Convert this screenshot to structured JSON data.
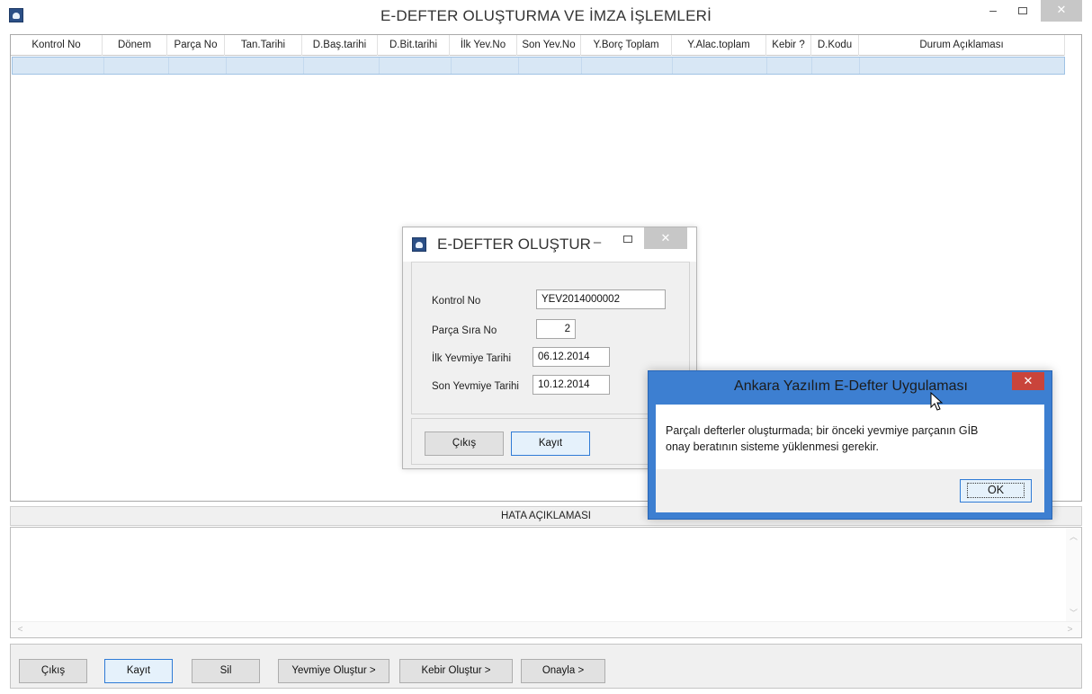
{
  "window": {
    "title": "E-DEFTER OLUŞTURMA VE İMZA İŞLEMLERİ",
    "min_glyph": "–",
    "close_glyph": "✕"
  },
  "grid": {
    "columns": [
      "Kontrol No",
      "Dönem",
      "Parça No",
      "Tan.Tarihi",
      "D.Baş.tarihi",
      "D.Bit.tarihi",
      "İlk Yev.No",
      "Son Yev.No",
      "Y.Borç Toplam",
      "Y.Alac.toplam",
      "Kebir ?",
      "D.Kodu",
      "Durum Açıklaması"
    ]
  },
  "error_section": {
    "header": "HATA AÇIKLAMASI",
    "content": "",
    "scroll_up": "︿",
    "scroll_down": "﹀",
    "scroll_left": "<",
    "scroll_right": ">"
  },
  "toolbar": {
    "exit": "Çıkış",
    "save": "Kayıt",
    "delete": "Sil",
    "create_journal": "Yevmiye Oluştur >",
    "create_ledger": "Kebir Oluştur >",
    "approve": "Onayla >"
  },
  "dialog": {
    "title": "E-DEFTER OLUŞTUR",
    "min_glyph": "–",
    "close_glyph": "✕",
    "fields": {
      "control_no_label": "Kontrol No",
      "control_no_value": "YEV2014000002",
      "part_no_label": "Parça Sıra No",
      "part_no_value": "2",
      "first_date_label": "İlk Yevmiye Tarihi",
      "first_date_value": "06.12.2014",
      "last_date_label": "Son Yevmiye Tarihi",
      "last_date_value": "10.12.2014"
    },
    "exit": "Çıkış",
    "save": "Kayıt"
  },
  "message_box": {
    "title": "Ankara Yazılım E-Defter Uygulaması",
    "close_glyph": "✕",
    "text_line1": "Parçalı defterler oluşturmada; bir önceki yevmiye parçanın GİB",
    "text_line2": "onay beratının sisteme yüklenmesi gerekir.",
    "ok": "OK"
  }
}
